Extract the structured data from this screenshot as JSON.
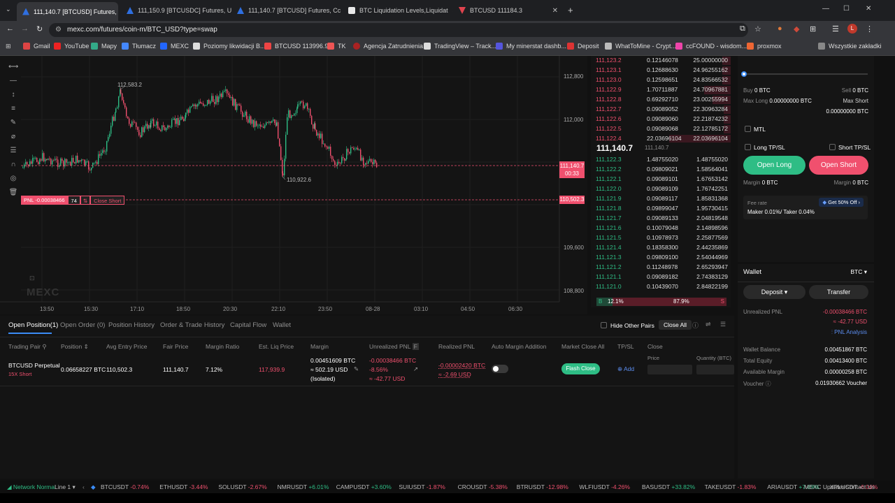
{
  "browser": {
    "tabs": [
      {
        "label": "111,140.7 [BTCUSD] Futures, Cc",
        "icon": "mexc-icon",
        "active": true
      },
      {
        "label": "111,150.9 [BTCUSDC] Futures, U",
        "icon": "mexc-icon",
        "active": false
      },
      {
        "label": "111,140.7 [BTCUSD] Futures, Cc",
        "icon": "mexc-icon",
        "active": false
      },
      {
        "label": "BTC Liquidation Levels,Liquidat",
        "icon": "coinglass-icon",
        "active": false
      },
      {
        "label": "BTCUSD 111184.3",
        "icon": "tradingview-icon",
        "active": false
      }
    ],
    "url": "mexc.com/futures/coin-m/BTC_USD?type=swap",
    "bookmarks": [
      "Gmail",
      "YouTube",
      "Mapy",
      "Tłumacz",
      "MEXC",
      "Poziomy likwidacji B...",
      "BTCUSD 113996.9",
      "TK",
      "Agencja Zatrudnienia",
      "TradingView – Track...",
      "My minerstat dashb...",
      "Deposit",
      "WhatToMine - Crypt...",
      "ccFOUND - wisdom...",
      "proxmox"
    ],
    "all_bookmarks": "Wszystkie zakładki"
  },
  "chart": {
    "high_label": "112,583.2",
    "low_label": "110,922.6",
    "price_ticks": [
      "112,800",
      "112,000",
      "109,600",
      "108,800"
    ],
    "time_ticks": [
      "13:50",
      "15:30",
      "17:10",
      "18:50",
      "20:30",
      "22:10",
      "23:50",
      "08-28",
      "03:10",
      "04:50",
      "06:30"
    ],
    "current_price_tag": "111,140.7",
    "countdown": "00:33",
    "position_price_tag": "110,502.3",
    "pnl_label": "PNL -0.00038466",
    "leverage_label": "74",
    "close_short_label": "Close Short",
    "watermark": "MEXC"
  },
  "orderbook": {
    "asks": [
      {
        "price": "111,123.2",
        "size": "0.12146078",
        "total": "25.00000000"
      },
      {
        "price": "111,123.1",
        "size": "0.12688630",
        "total": "24.96255162"
      },
      {
        "price": "111,123.0",
        "size": "0.12598651",
        "total": "24.83566532"
      },
      {
        "price": "111,122.9",
        "size": "1.70711887",
        "total": "24.70967881"
      },
      {
        "price": "111,122.8",
        "size": "0.69292710",
        "total": "23.00255994"
      },
      {
        "price": "111,122.7",
        "size": "0.09089052",
        "total": "22.30963284"
      },
      {
        "price": "111,122.6",
        "size": "0.09089060",
        "total": "22.21874232"
      },
      {
        "price": "111,122.5",
        "size": "0.09089068",
        "total": "22.12785172"
      },
      {
        "price": "111,122.4",
        "size": "22.03696104",
        "total": "22.03696104"
      }
    ],
    "last_price": "111,140.7",
    "mark_price": "111,140.7",
    "bids": [
      {
        "price": "111,122.3",
        "size": "1.48755020",
        "total": "1.48755020"
      },
      {
        "price": "111,122.2",
        "size": "0.09809021",
        "total": "1.58564041"
      },
      {
        "price": "111,122.1",
        "size": "0.09089101",
        "total": "1.67653142"
      },
      {
        "price": "111,122.0",
        "size": "0.09089109",
        "total": "1.76742251"
      },
      {
        "price": "111,121.9",
        "size": "0.09089117",
        "total": "1.85831368"
      },
      {
        "price": "111,121.8",
        "size": "0.09899047",
        "total": "1.95730415"
      },
      {
        "price": "111,121.7",
        "size": "0.09089133",
        "total": "2.04819548"
      },
      {
        "price": "111,121.6",
        "size": "0.10079048",
        "total": "2.14898596"
      },
      {
        "price": "111,121.5",
        "size": "0.10978973",
        "total": "2.25877569"
      },
      {
        "price": "111,121.4",
        "size": "0.18358300",
        "total": "2.44235869"
      },
      {
        "price": "111,121.3",
        "size": "0.09809100",
        "total": "2.54044969"
      },
      {
        "price": "111,121.2",
        "size": "0.11248978",
        "total": "2.65293947"
      },
      {
        "price": "111,121.1",
        "size": "0.09089182",
        "total": "2.74383129"
      },
      {
        "price": "111,121.0",
        "size": "0.10439070",
        "total": "2.84822199"
      }
    ],
    "buy_ratio_label": "B",
    "buy_ratio": "12.1%",
    "sell_ratio": "87.9%",
    "sell_ratio_label": "S",
    "buy_ratio_value": 0.121
  },
  "trade": {
    "buy_label": "Buy",
    "buy_value": "0 BTC",
    "sell_label": "Sell",
    "sell_value": "0 BTC",
    "max_long_label": "Max Long",
    "max_long_value": "0.00000000 BTC",
    "max_short_label": "Max Short",
    "max_short_value": "0.00000000 BTC",
    "mtl_label": "MTL",
    "long_tpsl_label": "Long TP/SL",
    "short_tpsl_label": "Short TP/SL",
    "open_long_label": "Open Long",
    "open_short_label": "Open Short",
    "margin_left_label": "Margin",
    "margin_left_value": "0 BTC",
    "margin_right_label": "Margin",
    "margin_right_value": "0 BTC",
    "fee_rate_label": "Fee rate",
    "fee_promo_label": "Get 50% Off",
    "fee_value": "Maker 0.01%/ Taker 0.04%"
  },
  "wallet": {
    "title": "Wallet",
    "currency": "BTC",
    "deposit_label": "Deposit",
    "transfer_label": "Transfer",
    "unrealized_pnl_label": "Unrealized PNL",
    "unrealized_pnl_value": "-0.00038466 BTC",
    "unrealized_pnl_usd": "≈ -42.77 USD",
    "pnl_analysis_label": "PNL Analysis",
    "rows": [
      {
        "label": "Wallet Balance",
        "value": "0.00451867 BTC"
      },
      {
        "label": "Total Equity",
        "value": "0.00413400 BTC"
      },
      {
        "label": "Available Margin",
        "value": "0.00000258 BTC"
      },
      {
        "label": "Voucher",
        "value": "0.01930662 Voucher"
      }
    ]
  },
  "positions": {
    "tabs": [
      "Open Position(1)",
      "Open Order (0)",
      "Position History",
      "Order & Trade History",
      "Capital Flow",
      "Wallet"
    ],
    "hide_other_pairs_label": "Hide Other Pairs",
    "close_all_label": "Close All",
    "headers": [
      "Trading Pair",
      "Position",
      "Avg Entry Price",
      "Fair Price",
      "Margin Ratio",
      "Est. Liq Price",
      "Margin",
      "Unrealized PNL",
      "Realized PNL",
      "Auto Margin Addition",
      "Market Close All",
      "TP/SL",
      "Close"
    ],
    "unrealized_flag": "F",
    "row": {
      "pair": "BTCUSD Perpetual",
      "side": "15X Short",
      "position": "0.06658227 BTC",
      "entry": "110,502.3",
      "fair": "111,140.7",
      "margin_ratio": "7.12%",
      "liq": "117,939.9",
      "margin_btc": "0.00451609 BTC",
      "margin_usd": "≈ 502.19 USD",
      "margin_type": "(Isolated)",
      "upnl_btc": "-0.00038466 BTC",
      "upnl_pct": "-8.56%",
      "upnl_usd": "≈ -42.77 USD",
      "rpnl_btc": "-0.00002420 BTC",
      "rpnl_usd": "≈ -2.69 USD",
      "flash_close": "Flash Close",
      "add_label": "Add",
      "price_label": "Price",
      "qty_label": "Quantity (BTC)"
    }
  },
  "status": {
    "network_label": "Network Normal",
    "line_label": "Line 1",
    "tickers": [
      {
        "sym": "BTCUSDT",
        "chg": "-0.74%",
        "up": false
      },
      {
        "sym": "ETHUSDT",
        "chg": "-3.44%",
        "up": false
      },
      {
        "sym": "SOLUSDT",
        "chg": "-2.67%",
        "up": false
      },
      {
        "sym": "NMRUSDT",
        "chg": "+6.01%",
        "up": true
      },
      {
        "sym": "CAMPUSDT",
        "chg": "+3.60%",
        "up": true
      },
      {
        "sym": "SUIUSDT",
        "chg": "-1.87%",
        "up": false
      },
      {
        "sym": "CROUSDT",
        "chg": "-5.38%",
        "up": false
      },
      {
        "sym": "BTRUSDT",
        "chg": "-12.98%",
        "up": false
      },
      {
        "sym": "WLFIUSDT",
        "chg": "-4.26%",
        "up": false
      },
      {
        "sym": "BASUSDT",
        "chg": "+33.82%",
        "up": true
      },
      {
        "sym": "TAKEUSDT",
        "chg": "-1.83%",
        "up": false
      },
      {
        "sym": "ARIAUSDT",
        "chg": "+7.89%",
        "up": true
      },
      {
        "sym": "XPLUSDT",
        "chg": "-6.06%",
        "up": false
      }
    ],
    "updates_label": "MEXC Updates",
    "contact_label": "Contact Us"
  },
  "colors": {
    "up": "#2ebd85",
    "down": "#f0506e",
    "accent": "#3b8cf6"
  }
}
